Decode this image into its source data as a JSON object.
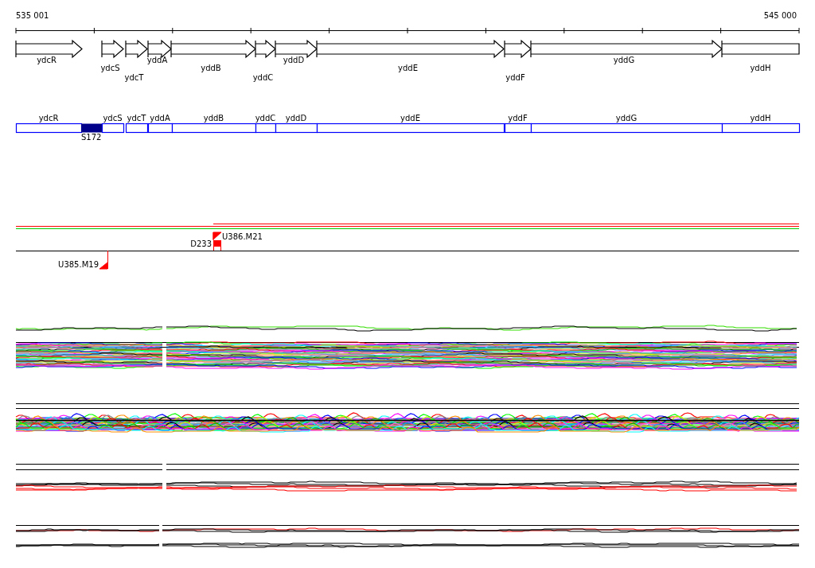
{
  "ruler": {
    "start_label": "535 001",
    "end_label": "545 000"
  },
  "gene_arrows": [
    {
      "label": "ydcR",
      "kind": "arrow"
    },
    {
      "label": "ydcS",
      "kind": "arrow"
    },
    {
      "label": "ydcT",
      "kind": "arrow"
    },
    {
      "label": "yddA",
      "kind": "arrow"
    },
    {
      "label": "yddB",
      "kind": "arrow"
    },
    {
      "label": "yddC",
      "kind": "arrow"
    },
    {
      "label": "yddD",
      "kind": "arrow"
    },
    {
      "label": "yddE",
      "kind": "arrow"
    },
    {
      "label": "yddF",
      "kind": "arrow"
    },
    {
      "label": "yddG",
      "kind": "arrow"
    },
    {
      "label": "yddH",
      "kind": "box"
    }
  ],
  "gene_boxes": [
    {
      "label": "ydcR"
    },
    {
      "label": "ydcS"
    },
    {
      "label": "ydcT"
    },
    {
      "label": "yddA"
    },
    {
      "label": "yddB"
    },
    {
      "label": "yddC"
    },
    {
      "label": "yddD"
    },
    {
      "label": "yddE"
    },
    {
      "label": "yddF"
    },
    {
      "label": "yddG"
    },
    {
      "label": "yddH"
    }
  ],
  "feature": {
    "label": "S172"
  },
  "markers": [
    {
      "label": "U386.M21",
      "kind": "flag"
    },
    {
      "label": "D233",
      "kind": "block"
    },
    {
      "label": "U385.M19",
      "kind": "pin"
    }
  ]
}
